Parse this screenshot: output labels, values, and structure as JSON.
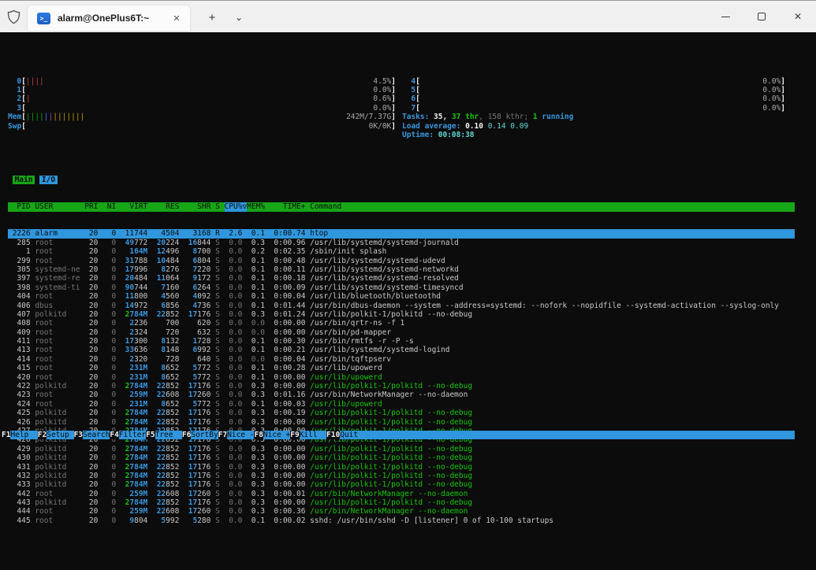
{
  "title_bar": {
    "tab_title": "alarm@OnePlus6T:~",
    "ps_icon_glyph": ">_",
    "tab_close_glyph": "✕",
    "new_tab_glyph": "+",
    "dropdown_glyph": "⌄",
    "close_glyph": "✕"
  },
  "colors": {
    "terminal_bg": "#0C0C0C",
    "accent_blue": "#3096DD",
    "header_green": "#16A616",
    "thread_green": "#16C60C",
    "bright_cyan": "#61D6D6",
    "dim_gray": "#767676",
    "normal_gray": "#C8C8C8",
    "bar_red": "#C14047",
    "bar_yellow": "#C19C00"
  },
  "meters": {
    "left": [
      {
        "label": "0",
        "bars": [
          [
            "red",
            4
          ]
        ],
        "value": "4.5%"
      },
      {
        "label": "1",
        "bars": [],
        "value": "0.0%"
      },
      {
        "label": "2",
        "bars": [
          [
            "red",
            1
          ]
        ],
        "value": "0.6%"
      },
      {
        "label": "3",
        "bars": [],
        "value": "0.0%"
      },
      {
        "label": "Mem",
        "bars": [
          [
            "green",
            4
          ],
          [
            "blue",
            1
          ],
          [
            "magenta",
            1
          ],
          [
            "yellow",
            7
          ]
        ],
        "value": "242M/7.37G"
      },
      {
        "label": "Swp",
        "bars": [],
        "value": "0K/0K"
      }
    ],
    "right": [
      {
        "label": "4",
        "bars": [],
        "value": "0.0%"
      },
      {
        "label": "5",
        "bars": [],
        "value": "0.0%"
      },
      {
        "label": "6",
        "bars": [],
        "value": "0.0%"
      },
      {
        "label": "7",
        "bars": [],
        "value": "0.0%"
      }
    ]
  },
  "info_lines": [
    {
      "name": "tasks-line",
      "segments": [
        [
          "label",
          "Tasks: "
        ],
        [
          "bold",
          "35, "
        ],
        [
          "green",
          "37 thr"
        ],
        [
          "dim",
          ", 158 kthr; "
        ],
        [
          "green",
          "1"
        ],
        [
          "label",
          " running"
        ]
      ]
    },
    {
      "name": "load-line",
      "segments": [
        [
          "label",
          "Load average: "
        ],
        [
          "bold",
          "0.10 "
        ],
        [
          "cyan",
          "0.14 "
        ],
        [
          "cyan",
          "0.09"
        ]
      ]
    },
    {
      "name": "uptime-line",
      "segments": [
        [
          "label",
          "Uptime: "
        ],
        [
          "cyanb",
          "00:08:38"
        ]
      ]
    }
  ],
  "screen_tabs": [
    {
      "label": "Main",
      "active": true
    },
    {
      "label": "I/O",
      "active": false
    }
  ],
  "columns": {
    "pid": "PID",
    "user": "USER",
    "pri": "PRI",
    "ni": "NI",
    "virt": "VIRT",
    "res": "RES",
    "shr": "SHR",
    "s": "S",
    "cpu": "CPU%",
    "sort_arrow": "▽",
    "mem": "MEM%",
    "time": "TIME+",
    "cmd": "Command"
  },
  "processes_fields": [
    "pid",
    "user",
    "pri",
    "ni",
    "virt",
    "res",
    "shr",
    "s",
    "cpu",
    "mem",
    "time",
    "cmd",
    "selected",
    "thread"
  ],
  "processes": [
    [
      "2226",
      "alarm",
      "20",
      "0",
      "11744",
      "4504",
      "3168",
      "R",
      "2.6",
      "0.1",
      "0:00.74",
      "htop",
      1,
      0
    ],
    [
      "285",
      "root",
      "20",
      "0",
      "49772",
      "20224",
      "16844",
      "S",
      "0.0",
      "0.3",
      "0:00.96",
      "/usr/lib/systemd/systemd-journald",
      0,
      0
    ],
    [
      "1",
      "root",
      "20",
      "0",
      "164M",
      "12496",
      "8700",
      "S",
      "0.0",
      "0.2",
      "0:02.35",
      "/sbin/init splash",
      0,
      0
    ],
    [
      "299",
      "root",
      "20",
      "0",
      "31788",
      "10484",
      "6804",
      "S",
      "0.0",
      "0.1",
      "0:00.48",
      "/usr/lib/systemd/systemd-udevd",
      0,
      0
    ],
    [
      "305",
      "systemd-ne",
      "20",
      "0",
      "17996",
      "8276",
      "7220",
      "S",
      "0.0",
      "0.1",
      "0:00.11",
      "/usr/lib/systemd/systemd-networkd",
      0,
      0
    ],
    [
      "397",
      "systemd-re",
      "20",
      "0",
      "20484",
      "11064",
      "9172",
      "S",
      "0.0",
      "0.1",
      "0:00.18",
      "/usr/lib/systemd/systemd-resolved",
      0,
      0
    ],
    [
      "398",
      "systemd-ti",
      "20",
      "0",
      "90744",
      "7160",
      "6264",
      "S",
      "0.0",
      "0.1",
      "0:00.09",
      "/usr/lib/systemd/systemd-timesyncd",
      0,
      0
    ],
    [
      "404",
      "root",
      "20",
      "0",
      "11800",
      "4560",
      "4092",
      "S",
      "0.0",
      "0.1",
      "0:00.04",
      "/usr/lib/bluetooth/bluetoothd",
      0,
      0
    ],
    [
      "406",
      "dbus",
      "20",
      "0",
      "14972",
      "6856",
      "4736",
      "S",
      "0.0",
      "0.1",
      "0:01.44",
      "/usr/bin/dbus-daemon --system --address=systemd: --nofork --nopidfile --systemd-activation --syslog-only",
      0,
      0
    ],
    [
      "407",
      "polkitd",
      "20",
      "0",
      "2784M",
      "22852",
      "17176",
      "S",
      "0.0",
      "0.3",
      "0:01.24",
      "/usr/lib/polkit-1/polkitd --no-debug",
      0,
      0
    ],
    [
      "408",
      "root",
      "20",
      "0",
      "2236",
      "700",
      "620",
      "S",
      "0.0",
      "0.0",
      "0:00.00",
      "/usr/bin/qrtr-ns -f 1",
      0,
      0
    ],
    [
      "409",
      "root",
      "20",
      "0",
      "2324",
      "720",
      "632",
      "S",
      "0.0",
      "0.0",
      "0:00.00",
      "/usr/bin/pd-mapper",
      0,
      0
    ],
    [
      "411",
      "root",
      "20",
      "0",
      "17300",
      "8132",
      "1728",
      "S",
      "0.0",
      "0.1",
      "0:00.30",
      "/usr/bin/rmtfs -r -P -s",
      0,
      0
    ],
    [
      "413",
      "root",
      "20",
      "0",
      "33636",
      "8148",
      "6992",
      "S",
      "0.0",
      "0.1",
      "0:00.21",
      "/usr/lib/systemd/systemd-logind",
      0,
      0
    ],
    [
      "414",
      "root",
      "20",
      "0",
      "2320",
      "728",
      "640",
      "S",
      "0.0",
      "0.0",
      "0:00.04",
      "/usr/bin/tqftpserv",
      0,
      0
    ],
    [
      "415",
      "root",
      "20",
      "0",
      "231M",
      "8652",
      "5772",
      "S",
      "0.0",
      "0.1",
      "0:00.28",
      "/usr/lib/upowerd",
      0,
      0
    ],
    [
      "420",
      "root",
      "20",
      "0",
      "231M",
      "8652",
      "5772",
      "S",
      "0.0",
      "0.1",
      "0:00.00",
      "/usr/lib/upowerd",
      0,
      1
    ],
    [
      "422",
      "polkitd",
      "20",
      "0",
      "2784M",
      "22852",
      "17176",
      "S",
      "0.0",
      "0.3",
      "0:00.00",
      "/usr/lib/polkit-1/polkitd --no-debug",
      0,
      1
    ],
    [
      "423",
      "root",
      "20",
      "0",
      "259M",
      "22608",
      "17260",
      "S",
      "0.0",
      "0.3",
      "0:01.16",
      "/usr/bin/NetworkManager --no-daemon",
      0,
      0
    ],
    [
      "424",
      "root",
      "20",
      "0",
      "231M",
      "8652",
      "5772",
      "S",
      "0.0",
      "0.1",
      "0:00.03",
      "/usr/lib/upowerd",
      0,
      1
    ],
    [
      "425",
      "polkitd",
      "20",
      "0",
      "2784M",
      "22852",
      "17176",
      "S",
      "0.0",
      "0.3",
      "0:00.19",
      "/usr/lib/polkit-1/polkitd --no-debug",
      0,
      1
    ],
    [
      "426",
      "polkitd",
      "20",
      "0",
      "2784M",
      "22852",
      "17176",
      "S",
      "0.0",
      "0.3",
      "0:00.00",
      "/usr/lib/polkit-1/polkitd --no-debug",
      0,
      1
    ],
    [
      "427",
      "polkitd",
      "20",
      "0",
      "2784M",
      "22852",
      "17176",
      "S",
      "0.0",
      "0.3",
      "0:00.00",
      "/usr/lib/polkit-1/polkitd --no-debug",
      0,
      1
    ],
    [
      "428",
      "polkitd",
      "20",
      "0",
      "2784M",
      "22852",
      "17176",
      "S",
      "0.0",
      "0.3",
      "0:00.00",
      "/usr/lib/polkit-1/polkitd --no-debug",
      0,
      1
    ],
    [
      "429",
      "polkitd",
      "20",
      "0",
      "2784M",
      "22852",
      "17176",
      "S",
      "0.0",
      "0.3",
      "0:00.00",
      "/usr/lib/polkit-1/polkitd --no-debug",
      0,
      1
    ],
    [
      "430",
      "polkitd",
      "20",
      "0",
      "2784M",
      "22852",
      "17176",
      "S",
      "0.0",
      "0.3",
      "0:00.00",
      "/usr/lib/polkit-1/polkitd --no-debug",
      0,
      1
    ],
    [
      "431",
      "polkitd",
      "20",
      "0",
      "2784M",
      "22852",
      "17176",
      "S",
      "0.0",
      "0.3",
      "0:00.00",
      "/usr/lib/polkit-1/polkitd --no-debug",
      0,
      1
    ],
    [
      "432",
      "polkitd",
      "20",
      "0",
      "2784M",
      "22852",
      "17176",
      "S",
      "0.0",
      "0.3",
      "0:00.00",
      "/usr/lib/polkit-1/polkitd --no-debug",
      0,
      1
    ],
    [
      "433",
      "polkitd",
      "20",
      "0",
      "2784M",
      "22852",
      "17176",
      "S",
      "0.0",
      "0.3",
      "0:00.00",
      "/usr/lib/polkit-1/polkitd --no-debug",
      0,
      1
    ],
    [
      "442",
      "root",
      "20",
      "0",
      "259M",
      "22608",
      "17260",
      "S",
      "0.0",
      "0.3",
      "0:00.01",
      "/usr/bin/NetworkManager --no-daemon",
      0,
      1
    ],
    [
      "443",
      "polkitd",
      "20",
      "0",
      "2784M",
      "22852",
      "17176",
      "S",
      "0.0",
      "0.3",
      "0:00.00",
      "/usr/lib/polkit-1/polkitd --no-debug",
      0,
      1
    ],
    [
      "444",
      "root",
      "20",
      "0",
      "259M",
      "22608",
      "17260",
      "S",
      "0.0",
      "0.3",
      "0:00.36",
      "/usr/bin/NetworkManager --no-daemon",
      0,
      1
    ],
    [
      "445",
      "root",
      "20",
      "0",
      "9804",
      "5992",
      "5280",
      "S",
      "0.0",
      "0.1",
      "0:00.02",
      "sshd: /usr/bin/sshd -D [listener] 0 of 10-100 startups",
      0,
      0
    ]
  ],
  "fnbar": [
    [
      "F1",
      "Help  "
    ],
    [
      "F2",
      "Setup "
    ],
    [
      "F3",
      "Search"
    ],
    [
      "F4",
      "Filter"
    ],
    [
      "F5",
      "Tree  "
    ],
    [
      "F6",
      "SortBy"
    ],
    [
      "F7",
      "Nice -"
    ],
    [
      "F8",
      "Nice +"
    ],
    [
      "F9",
      "Kill  "
    ],
    [
      "F10",
      "Quit  "
    ]
  ]
}
